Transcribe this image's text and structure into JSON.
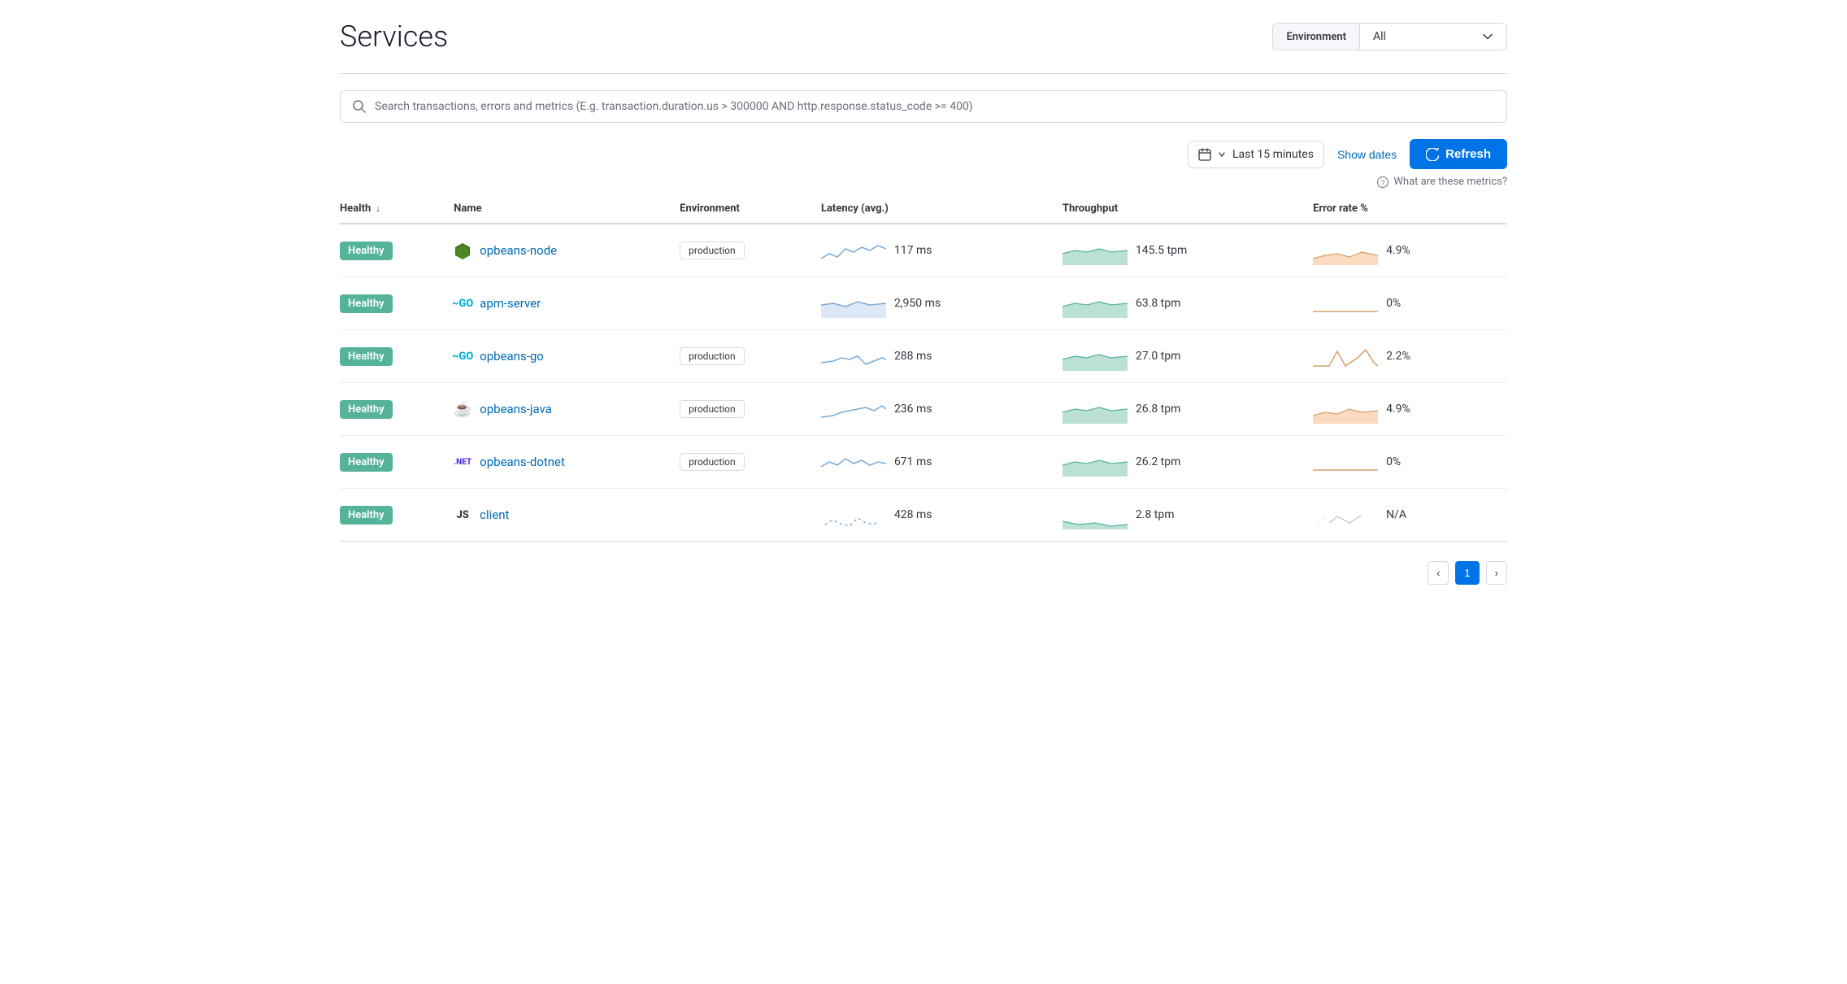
{
  "page": {
    "title": "Services"
  },
  "env_selector": {
    "label": "Environment",
    "value": "All"
  },
  "search": {
    "placeholder": "Search transactions, errors and metrics (E.g. transaction.duration.us > 300000 AND http.response.status_code >= 400)"
  },
  "time_controls": {
    "time_range": "Last 15 minutes",
    "show_dates_label": "Show dates",
    "refresh_label": "Refresh"
  },
  "metrics_help": {
    "text": "What are these metrics?"
  },
  "table": {
    "columns": [
      "Health",
      "Name",
      "Environment",
      "Latency (avg.)",
      "Throughput",
      "Error rate %"
    ],
    "rows": [
      {
        "health": "Healthy",
        "icon_type": "node",
        "name": "opbeans-node",
        "environment": "production",
        "latency": "117 ms",
        "throughput": "145.5 tpm",
        "error_rate": "4.9%",
        "latency_sparkline": "latency-wavy",
        "throughput_sparkline": "throughput-green",
        "error_sparkline": "error-orange"
      },
      {
        "health": "Healthy",
        "icon_type": "go",
        "name": "apm-server",
        "environment": "",
        "latency": "2,950 ms",
        "throughput": "63.8 tpm",
        "error_rate": "0%",
        "latency_sparkline": "latency-flat",
        "throughput_sparkline": "throughput-green",
        "error_sparkline": "error-flat"
      },
      {
        "health": "Healthy",
        "icon_type": "go",
        "name": "opbeans-go",
        "environment": "production",
        "latency": "288 ms",
        "throughput": "27.0 tpm",
        "error_rate": "2.2%",
        "latency_sparkline": "latency-spike",
        "throughput_sparkline": "throughput-green",
        "error_sparkline": "error-spike"
      },
      {
        "health": "Healthy",
        "icon_type": "java",
        "name": "opbeans-java",
        "environment": "production",
        "latency": "236 ms",
        "throughput": "26.8 tpm",
        "error_rate": "4.9%",
        "latency_sparkline": "latency-rise",
        "throughput_sparkline": "throughput-green",
        "error_sparkline": "error-wavy"
      },
      {
        "health": "Healthy",
        "icon_type": "dotnet",
        "name": "opbeans-dotnet",
        "environment": "production",
        "latency": "671 ms",
        "throughput": "26.2 tpm",
        "error_rate": "0%",
        "latency_sparkline": "latency-bumpy",
        "throughput_sparkline": "throughput-green",
        "error_sparkline": "error-flat2"
      },
      {
        "health": "Healthy",
        "icon_type": "js",
        "name": "client",
        "environment": "",
        "latency": "428 ms",
        "throughput": "2.8 tpm",
        "error_rate": "N/A",
        "latency_sparkline": "latency-sparse",
        "throughput_sparkline": "throughput-sparse",
        "error_sparkline": "error-na"
      }
    ]
  },
  "pagination": {
    "prev_label": "‹",
    "next_label": "›",
    "current_page": "1"
  }
}
